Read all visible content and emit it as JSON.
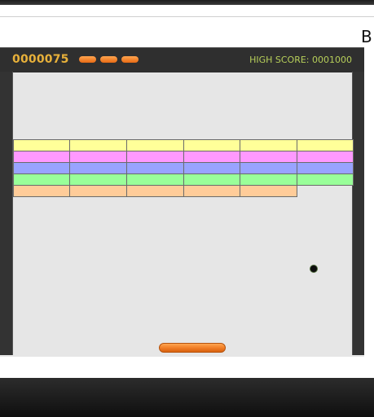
{
  "browser": {
    "edge_text": "B"
  },
  "game": {
    "score": "0000075",
    "lives_remaining": 3,
    "high_score": "HIGH SCORE: 0001000",
    "brick_rows": [
      {
        "color": "#ffff99",
        "count": 6
      },
      {
        "color": "#ff99ff",
        "count": 6
      },
      {
        "color": "#99a3ff",
        "count": 6
      },
      {
        "color": "#99ff99",
        "count": 6
      },
      {
        "color": "#ffcc99",
        "count": 5
      }
    ],
    "colors": {
      "background": "#e6e6e6",
      "wall": "#333333",
      "hud": "#2f2f2f",
      "score_text": "#e8b13a",
      "high_score_text": "#b7cf5a",
      "paddle": "#ef7b24",
      "ball": "#0d0d0d"
    }
  }
}
